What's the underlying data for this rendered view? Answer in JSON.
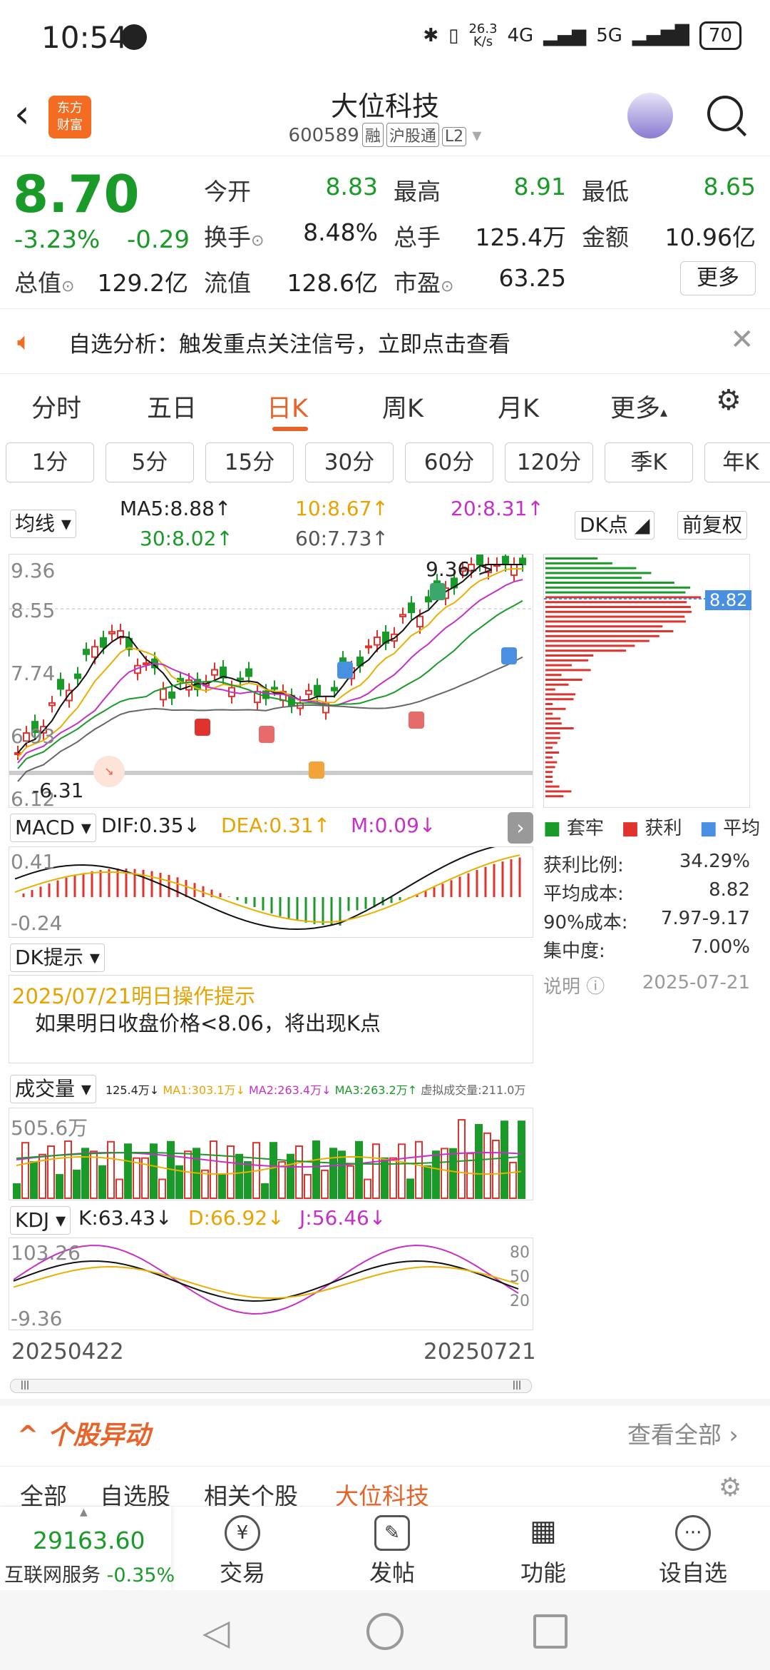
{
  "status": {
    "time": "10:54",
    "net_speed_top": "26.3",
    "net_speed_unit": "K/s",
    "sig1": "4G",
    "sig2": "5G",
    "battery": "70"
  },
  "header": {
    "logo_line1": "东方",
    "logo_line2": "财富",
    "title": "大位科技",
    "code": "600589",
    "tags": [
      "融",
      "沪股通",
      "L2"
    ]
  },
  "quote": {
    "price": "8.70",
    "change_pct": "-3.23%",
    "change": "-0.29",
    "cells": [
      {
        "label": "今开",
        "value": "8.83",
        "color": "green"
      },
      {
        "label": "最高",
        "value": "8.91",
        "color": "green"
      },
      {
        "label": "最低",
        "value": "8.65",
        "color": "green"
      },
      {
        "label": "换手",
        "value": "8.48%",
        "color": "black"
      },
      {
        "label": "总手",
        "value": "125.4万",
        "color": "black"
      },
      {
        "label": "金额",
        "value": "10.96亿",
        "color": "black"
      },
      {
        "label": "总值",
        "value": "129.2亿",
        "color": "black"
      },
      {
        "label": "流值",
        "value": "128.6亿",
        "color": "black"
      },
      {
        "label": "市盈",
        "value": "63.25",
        "color": "black"
      }
    ],
    "more": "更多"
  },
  "notice": {
    "text": "自选分析：触发重点关注信号，立即点击查看"
  },
  "tabs": [
    "分时",
    "五日",
    "日K",
    "周K",
    "月K",
    "更多"
  ],
  "periods": [
    "1分",
    "5分",
    "15分",
    "30分",
    "60分",
    "120分",
    "季K",
    "年K"
  ],
  "ma": {
    "label": "均线",
    "ma5": "MA5:8.88↑",
    "ma10": "10:8.67↑",
    "ma20": "20:8.31↑",
    "ma30": "30:8.02↑",
    "ma60": "60:7.73↑",
    "dk": "DK点",
    "fq": "前复权"
  },
  "kline": {
    "y_top": "9.36",
    "y_mid": "8.55",
    "y_low": "7.74",
    "y_low2": "6.93",
    "y_min": "6.12",
    "max_label": "9.36->",
    "min_label": "-6.31",
    "cost_label": "8.82"
  },
  "macd": {
    "label": "MACD",
    "dif": "DIF:0.35↓",
    "dea": "DEA:0.31↑",
    "m": "M:0.09↓",
    "y_top": "0.41",
    "y_bot": "-0.24"
  },
  "chip": {
    "legend": [
      "套牢",
      "获利",
      "平均"
    ],
    "rows": [
      {
        "label": "获利比例:",
        "value": "34.29%"
      },
      {
        "label": "平均成本:",
        "value": "8.82"
      },
      {
        "label": "90%成本:",
        "value": "7.97-9.17"
      },
      {
        "label": "集中度:",
        "value": "7.00%"
      }
    ],
    "note": "说明",
    "date": "2025-07-21"
  },
  "dk": {
    "label": "DK提示",
    "title": "2025/07/21明日操作提示",
    "body": "如果明日收盘价格<8.06，将出现K点"
  },
  "volume": {
    "label": "成交量",
    "v": "125.4万↓",
    "ma1": "MA1:303.1万↓",
    "ma2": "MA2:263.4万↓",
    "ma3": "MA3:263.2万↑",
    "virt": "虚拟成交量:211.0万",
    "y_top": "505.6万"
  },
  "kdj": {
    "label": "KDJ",
    "k": "K:63.43↓",
    "d": "D:66.92↓",
    "j": "J:56.46↓",
    "y_top": "103.26",
    "y_bot": "-9.36",
    "r80": "80",
    "r50": "50",
    "r20": "20"
  },
  "dates": {
    "start": "20250422",
    "end": "20250721"
  },
  "anomaly": {
    "title": "个股异动",
    "view_all": "查看全部"
  },
  "subtabs": [
    "全部",
    "自选股",
    "相关个股",
    "大位科技"
  ],
  "index": {
    "value": "29163.60",
    "name": "互联网服务",
    "pct": "-0.35%"
  },
  "nav": [
    "交易",
    "发帖",
    "功能",
    "设自选"
  ]
}
